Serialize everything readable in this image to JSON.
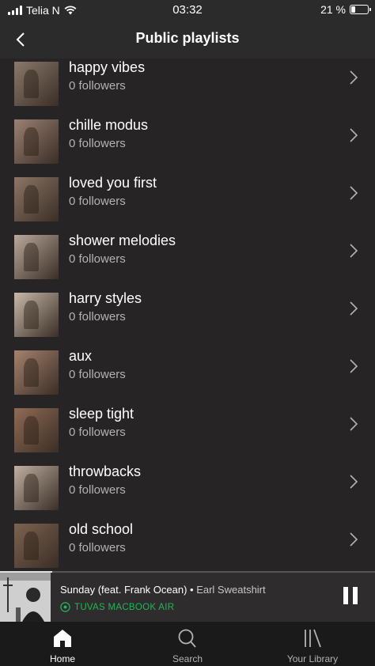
{
  "status": {
    "carrier": "Telia N",
    "time": "03:32",
    "battery": "21 %",
    "battery_level": 0.21
  },
  "header": {
    "title": "Public playlists",
    "back_icon": "chevron-left-icon"
  },
  "playlists": [
    {
      "name": "happy vibes",
      "followers": "0 followers",
      "thumb_color": "#8a7a6c"
    },
    {
      "name": "chille modus",
      "followers": "0 followers",
      "thumb_color": "#9b8173"
    },
    {
      "name": "loved you first",
      "followers": "0 followers",
      "thumb_color": "#8c7666"
    },
    {
      "name": "shower melodies",
      "followers": "0 followers",
      "thumb_color": "#b9a99b"
    },
    {
      "name": "harry styles",
      "followers": "0 followers",
      "thumb_color": "#c7b9a9"
    },
    {
      "name": "aux",
      "followers": "0 followers",
      "thumb_color": "#a5826f"
    },
    {
      "name": "sleep tight",
      "followers": "0 followers",
      "thumb_color": "#8f6b55"
    },
    {
      "name": "throwbacks",
      "followers": "0 followers",
      "thumb_color": "#bfb0a2"
    },
    {
      "name": "old school",
      "followers": "0 followers",
      "thumb_color": "#7d6350"
    }
  ],
  "now_playing": {
    "title": "Sunday (feat. Frank Ocean)",
    "separator": " • ",
    "artist": "Earl Sweatshirt",
    "device": "TUVAS MACBOOK AIR",
    "progress": 0.14,
    "accent_color": "#1db954"
  },
  "tabs": [
    {
      "label": "Home",
      "icon": "home-icon",
      "active": true
    },
    {
      "label": "Search",
      "icon": "search-icon",
      "active": false
    },
    {
      "label": "Your Library",
      "icon": "library-icon",
      "active": false
    }
  ]
}
